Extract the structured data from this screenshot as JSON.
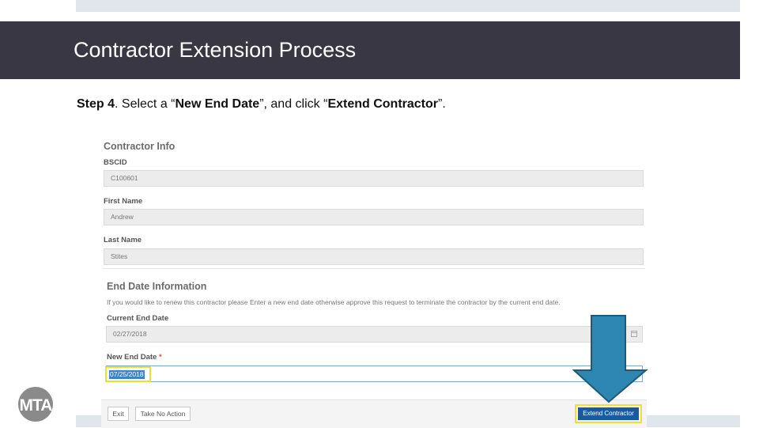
{
  "slide": {
    "title": "Contractor Extension Process",
    "instruction": {
      "step": "Step 4",
      "text_a": ". Select a “",
      "bold_a": "New End Date",
      "text_b": "”, and click “",
      "bold_b": "Extend Contractor",
      "text_c": "”."
    },
    "logo_text": "MTA"
  },
  "form": {
    "contractor_info": {
      "title": "Contractor Info",
      "bscid_label": "BSCID",
      "bscid_value": "C100601",
      "first_name_label": "First Name",
      "first_name_value": "Andrew",
      "last_name_label": "Last Name",
      "last_name_value": "Stites"
    },
    "end_date_info": {
      "title": "End Date Information",
      "info_text": "If you would like to renew this contractor please Enter a new end date otherwise approve this request to terminate the contractor by the current end date.",
      "current_end_date_label": "Current End Date",
      "current_end_date_value": "02/27/2018",
      "new_end_date_label": "New End Date",
      "required_marker": "*",
      "new_end_date_value": "07/25/2018"
    },
    "buttons": {
      "exit": "Exit",
      "take_no_action": "Take No Action",
      "extend_contractor": "Extend Contractor"
    }
  },
  "colors": {
    "title_bar": "#383743",
    "primary_button": "#1a5aa3",
    "highlight_box": "#e8e234",
    "arrow": "#2e86b3",
    "arrow_outline": "#1c5a7c"
  },
  "icons": [
    "calendar-icon",
    "down-arrow-icon"
  ]
}
